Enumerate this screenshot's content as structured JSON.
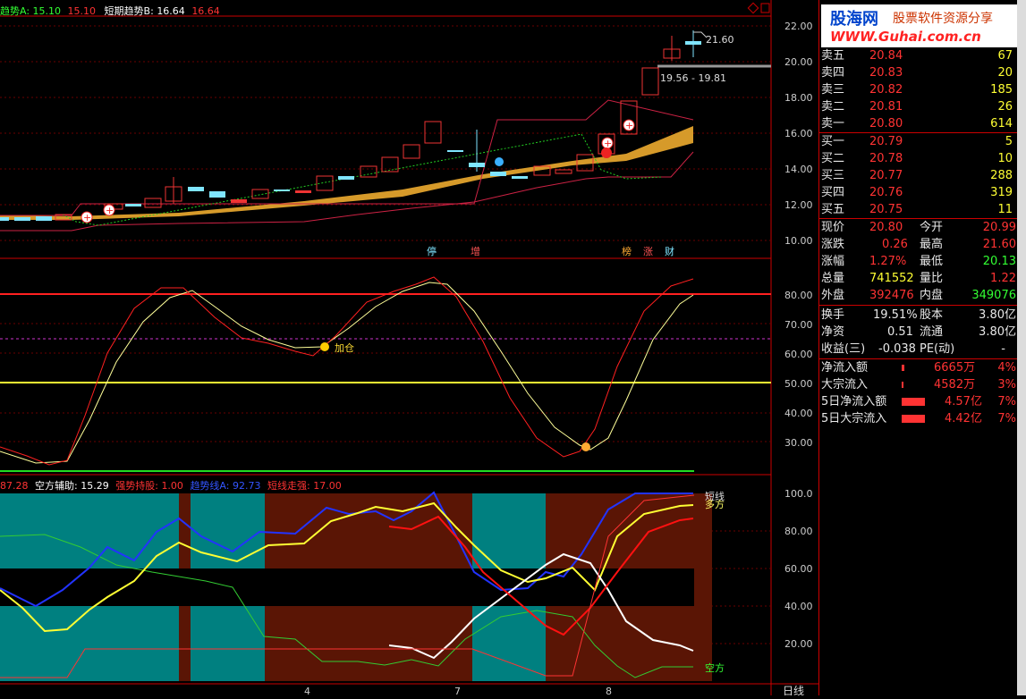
{
  "header_top": {
    "a_label": "趋势A:",
    "a_val1": "15.10",
    "a_val2": "15.10",
    "b_label": "短期趋势B:",
    "b_val1": "16.64",
    "b_val2": "16.64"
  },
  "price_axis": [
    "22.00",
    "20.00",
    "18.00",
    "16.00",
    "14.00",
    "12.00",
    "10.00"
  ],
  "price_annotations": {
    "high": "21.60",
    "range": "19.56 - 19.81"
  },
  "event_markers": [
    "停",
    "增",
    "榜",
    "涨",
    "财"
  ],
  "osc_axis": [
    "80.00",
    "70.00",
    "60.00",
    "50.00",
    "40.00",
    "30.00"
  ],
  "osc_annotation": "加仓",
  "header_bottom": {
    "v0": "87.28",
    "k1": "空方辅助:",
    "v1": "15.29",
    "k2": "强势持股:",
    "v2": "1.00",
    "k3": "趋势线A:",
    "v3": "92.73",
    "k4": "短线走强:",
    "v4": "17.00"
  },
  "bottom_axis": [
    "100.0",
    "80.00",
    "60.00",
    "40.00",
    "20.00"
  ],
  "bottom_labels": {
    "short": "短线",
    "long": "多方",
    "air": "空方"
  },
  "x_axis": [
    "4",
    "7",
    "8"
  ],
  "period": "日线",
  "logo": {
    "title": "股海网",
    "subtitle": "股票软件资源分享",
    "url": "WWW.Guhai.com.cn"
  },
  "quote": {
    "sell": [
      {
        "label": "卖五",
        "price": "20.84",
        "vol": "67"
      },
      {
        "label": "卖四",
        "price": "20.83",
        "vol": "20"
      },
      {
        "label": "卖三",
        "price": "20.82",
        "vol": "185"
      },
      {
        "label": "卖二",
        "price": "20.81",
        "vol": "26"
      },
      {
        "label": "卖一",
        "price": "20.80",
        "vol": "614"
      }
    ],
    "buy": [
      {
        "label": "买一",
        "price": "20.79",
        "vol": "5"
      },
      {
        "label": "买二",
        "price": "20.78",
        "vol": "10"
      },
      {
        "label": "买三",
        "price": "20.77",
        "vol": "288"
      },
      {
        "label": "买四",
        "price": "20.76",
        "vol": "319"
      },
      {
        "label": "买五",
        "price": "20.75",
        "vol": "11"
      }
    ],
    "stats": [
      {
        "l1": "现价",
        "v1": "20.80",
        "l2": "今开",
        "v2": "20.99",
        "c1": "red",
        "c2": "red"
      },
      {
        "l1": "涨跌",
        "v1": "0.26",
        "l2": "最高",
        "v2": "21.60",
        "c1": "red",
        "c2": "red"
      },
      {
        "l1": "涨幅",
        "v1": "1.27%",
        "l2": "最低",
        "v2": "20.13",
        "c1": "red",
        "c2": "grn"
      },
      {
        "l1": "总量",
        "v1": "741552",
        "l2": "量比",
        "v2": "1.22",
        "c1": "yel",
        "c2": "red"
      },
      {
        "l1": "外盘",
        "v1": "392476",
        "l2": "内盘",
        "v2": "349076",
        "c1": "red",
        "c2": "grn"
      }
    ],
    "stats2": [
      {
        "l1": "换手",
        "v1": "19.51%",
        "l2": "股本",
        "v2": "3.80亿"
      },
      {
        "l1": "净资",
        "v1": "0.51",
        "l2": "流通",
        "v2": "3.80亿"
      },
      {
        "l1": "收益(三)",
        "v1": "-0.038",
        "l2": "PE(动)",
        "v2": "-"
      }
    ],
    "flows": [
      {
        "label": "净流入额",
        "value": "6665万",
        "pct": "4%",
        "bar": 0.05
      },
      {
        "label": "大宗流入",
        "value": "4582万",
        "pct": "3%",
        "bar": 0.04
      },
      {
        "label": "5日净流入额",
        "value": "4.57亿",
        "pct": "7%",
        "bar": 0.9
      },
      {
        "label": "5日大宗流入",
        "value": "4.42亿",
        "pct": "7%",
        "bar": 0.9
      }
    ]
  }
}
